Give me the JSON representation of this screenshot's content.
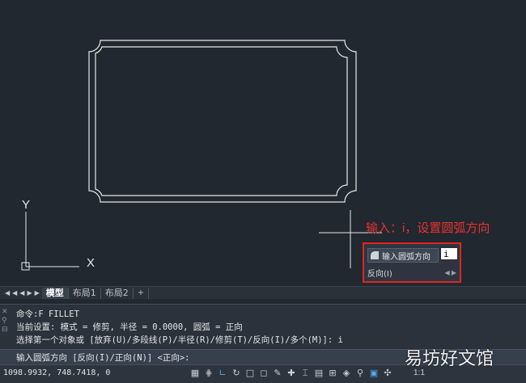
{
  "annotation": {
    "text": "输入：i，设置圆弧方向"
  },
  "dynamic_prompt": {
    "label": "输入圆弧方向",
    "input_value": "i",
    "option": "反向(I)",
    "arrows": "◀ ▶"
  },
  "ucs": {
    "y_label": "Y",
    "x_label": "X"
  },
  "layout_tabs": {
    "nav": "◀◀◀▶▶",
    "tabs": [
      {
        "label": "模型",
        "active": true
      },
      {
        "label": "布局1",
        "active": false
      },
      {
        "label": "布局2",
        "active": false
      },
      {
        "label": "+",
        "active": false
      }
    ]
  },
  "command_history": [
    "命令:F FILLET",
    "当前设置: 模式 = 修剪, 半径 = 0.0000, 圆弧 = 正向",
    "选择第一个对象或 [放弃(U)/多段线(P)/半径(R)/修剪(T)/反向(I)/多个(M)]: i"
  ],
  "command_input": "输入圆弧方向 [反向(I)/正向(N)] <正向>:",
  "status": {
    "coordinates": "1098.9932, 748.7418, 0",
    "scale": "1:1",
    "icons": [
      "grid-icon",
      "snap-icon",
      "ortho-icon",
      "polar-icon",
      "osnap-icon",
      "otrack-icon",
      "dyn-icon",
      "lineweight-icon",
      "transparency-icon",
      "selection-cycling-icon",
      "annotation-icon",
      "annotation-scale-icon",
      "workspace-icon",
      "gear-icon"
    ]
  },
  "watermark": {
    "text": "易坊好文馆"
  },
  "colors": {
    "background": "#212830",
    "geometry": "#e8e8e8",
    "annotation": "#e8322e",
    "highlight_border": "#e02424"
  }
}
